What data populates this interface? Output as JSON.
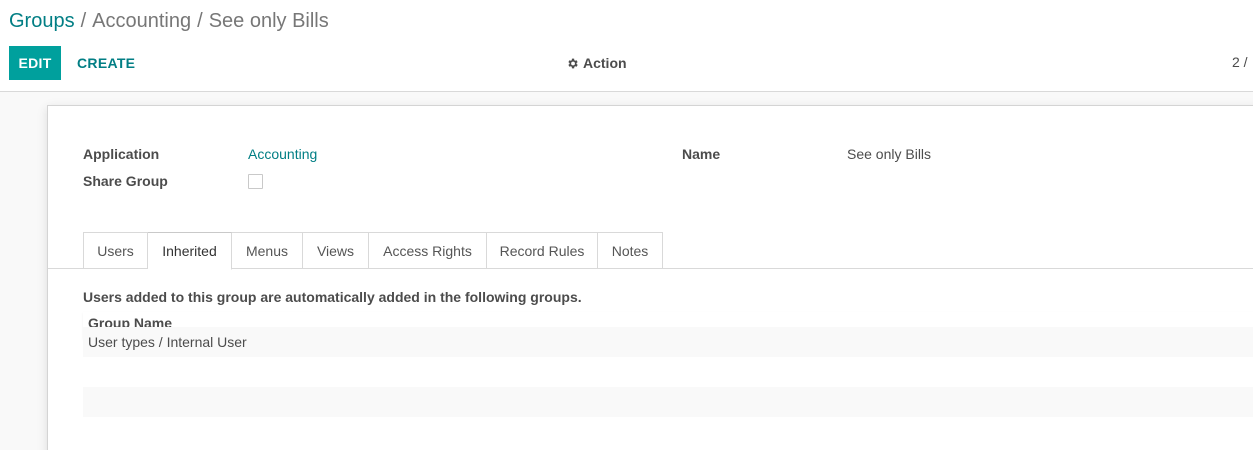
{
  "breadcrumb": {
    "root": "Groups",
    "sep1": "/",
    "middle": "Accounting",
    "sep2": "/",
    "current": "See only Bills"
  },
  "buttons": {
    "edit": "EDIT",
    "create": "CREATE"
  },
  "action_menu": {
    "label": "Action",
    "icon": "gear-icon"
  },
  "pager": {
    "text": "2 /"
  },
  "form": {
    "application_label": "Application",
    "application_value": "Accounting",
    "share_group_label": "Share Group",
    "share_group_checked": false,
    "name_label": "Name",
    "name_value": "See only Bills"
  },
  "tabs": [
    {
      "label": "Users",
      "active": false
    },
    {
      "label": "Inherited",
      "active": true
    },
    {
      "label": "Menus",
      "active": false
    },
    {
      "label": "Views",
      "active": false
    },
    {
      "label": "Access Rights",
      "active": false
    },
    {
      "label": "Record Rules",
      "active": false
    },
    {
      "label": "Notes",
      "active": false
    }
  ],
  "inherited": {
    "help_text": "Users added to this group are automatically added in the following groups.",
    "column_header": "Group Name",
    "rows": [
      "User types / Internal User",
      ""
    ]
  },
  "colors": {
    "primary": "#00a09d",
    "link": "#017e84"
  }
}
